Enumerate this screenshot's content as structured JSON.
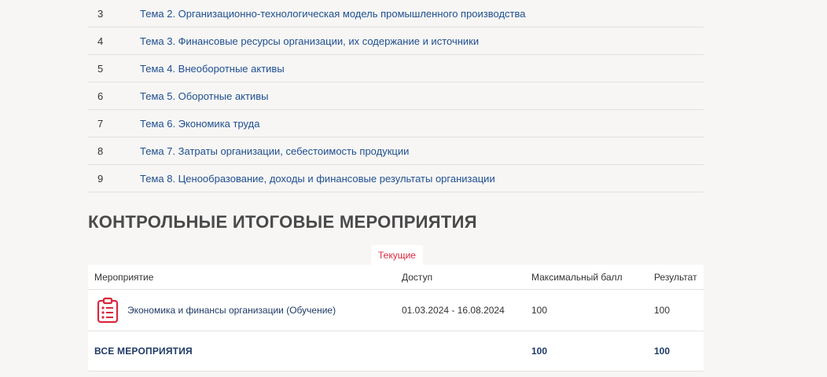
{
  "topics": [
    {
      "num": "3",
      "title": "Тема 2. Организационно-технологическая модель промышленного производства"
    },
    {
      "num": "4",
      "title": "Тема 3. Финансовые ресурсы организации, их содержание и источники"
    },
    {
      "num": "5",
      "title": "Тема 4. Внеоборотные активы"
    },
    {
      "num": "6",
      "title": "Тема 5. Оборотные активы"
    },
    {
      "num": "7",
      "title": "Тема 6. Экономика труда"
    },
    {
      "num": "8",
      "title": "Тема 7. Затраты организации, себестоимость продукции"
    },
    {
      "num": "9",
      "title": "Тема 8. Ценообразование, доходы и финансовые результаты организации"
    }
  ],
  "section": {
    "title": "КОНТРОЛЬНЫЕ ИТОГОВЫЕ МЕРОПРИЯТИЯ",
    "tab": "Текущие"
  },
  "table": {
    "headers": [
      "Мероприятие",
      "Доступ",
      "Максимальный балл",
      "Результат"
    ],
    "row": {
      "icon": "clipboard-list-icon",
      "name": "Экономика и финансы организации (Обучение)",
      "access": "01.03.2024 - 16.08.2024",
      "max": "100",
      "result": "100"
    },
    "total": {
      "label": "ВСЕ МЕРОПРИЯТИЯ",
      "max": "100",
      "result": "100"
    }
  },
  "colors": {
    "accent": "#d9283e",
    "link": "#1f4f8f",
    "background": "#f7f6f5"
  }
}
